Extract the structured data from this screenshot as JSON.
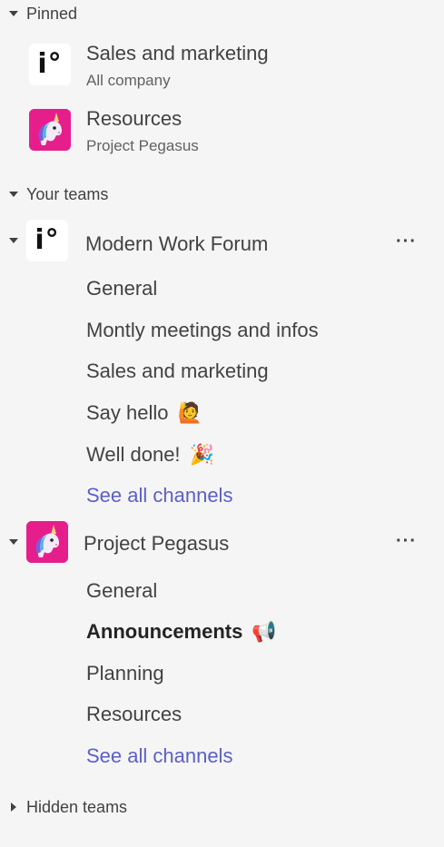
{
  "pinned": {
    "header": "Pinned",
    "items": [
      {
        "title": "Sales and marketing",
        "subtitle": "All company",
        "avatar_icon": "company-logo-icon",
        "logo_text": "i°"
      },
      {
        "title": "Resources",
        "subtitle": "Project Pegasus",
        "avatar_icon": "unicorn-icon"
      }
    ]
  },
  "your_teams": {
    "header": "Your teams",
    "teams": [
      {
        "name": "Modern Work Forum",
        "avatar_icon": "company-logo-icon",
        "logo_text": "i°",
        "more_label": "···",
        "channels": [
          {
            "label": "General"
          },
          {
            "label": "Montly meetings and infos"
          },
          {
            "label": "Sales and marketing"
          },
          {
            "label": "Say hello",
            "emoji": "🙋",
            "emoji_icon": "person-raising-hand-icon"
          },
          {
            "label": "Well done!",
            "emoji": "🎉",
            "emoji_icon": "party-popper-icon"
          }
        ],
        "see_all": "See all channels"
      },
      {
        "name": "Project Pegasus",
        "avatar_icon": "unicorn-icon",
        "more_label": "···",
        "channels": [
          {
            "label": "General"
          },
          {
            "label": "Announcements",
            "emoji": "📢",
            "emoji_icon": "megaphone-icon",
            "unread": true
          },
          {
            "label": "Planning"
          },
          {
            "label": "Resources"
          }
        ],
        "see_all": "See all channels"
      }
    ]
  },
  "hidden_teams": {
    "header": "Hidden teams"
  },
  "colors": {
    "background": "#f5f5f5",
    "text": "#424242",
    "link": "#5b5fc7",
    "unicorn_tile": "#e61e8c"
  }
}
